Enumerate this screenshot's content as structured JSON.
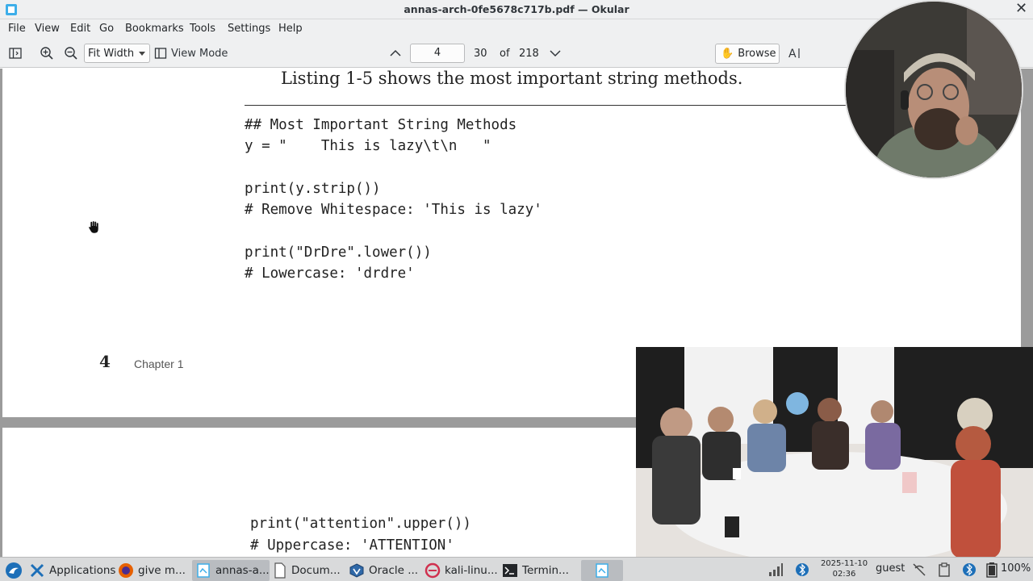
{
  "window": {
    "title": "annas-arch-0fe5678c717b.pdf — Okular",
    "close_glyph": "✕"
  },
  "menu": [
    "File",
    "View",
    "Edit",
    "Go",
    "Bookmarks",
    "Tools",
    "Settings",
    "Help"
  ],
  "toolbar": {
    "zoom_mode": "Fit Width",
    "view_mode_label": "View Mode",
    "page_input": "4",
    "page_label": "30",
    "of_label": "of",
    "total_pages": "218",
    "browse_label": "Browse"
  },
  "document": {
    "heading": "Listing 1-5 shows the most important string methods.",
    "code_lines": [
      "## Most Important String Methods",
      "y = \"    This is lazy\\t\\n   \"",
      "",
      "print(y.strip())",
      "# Remove Whitespace: 'This is lazy'",
      "",
      "print(\"DrDre\".lower())",
      "# Lowercase: 'drdre'"
    ],
    "page_number": "4",
    "chapter_label": "Chapter 1",
    "next_page_code": [
      "print(\"attention\".upper())",
      "# Uppercase: 'ATTENTION'"
    ]
  },
  "taskbar": {
    "apps_label": "Applications",
    "tasks": [
      {
        "label": "give m...",
        "icon": "firefox-icon"
      },
      {
        "label": "annas-a...",
        "icon": "okular-icon"
      },
      {
        "label": "Docum...",
        "icon": "document-icon"
      },
      {
        "label": "Oracle ...",
        "icon": "virtualbox-icon"
      },
      {
        "label": "kali-linu...",
        "icon": "kali-icon"
      },
      {
        "label": "Termin...",
        "icon": "terminal-icon"
      }
    ],
    "clock_date": "2025-11-10",
    "clock_time": "02:36",
    "user": "guest",
    "battery": "100%"
  },
  "colors": {
    "accent": "#3daee9",
    "panel": "#eff0f1",
    "doc_background": "#9b9b9b"
  }
}
